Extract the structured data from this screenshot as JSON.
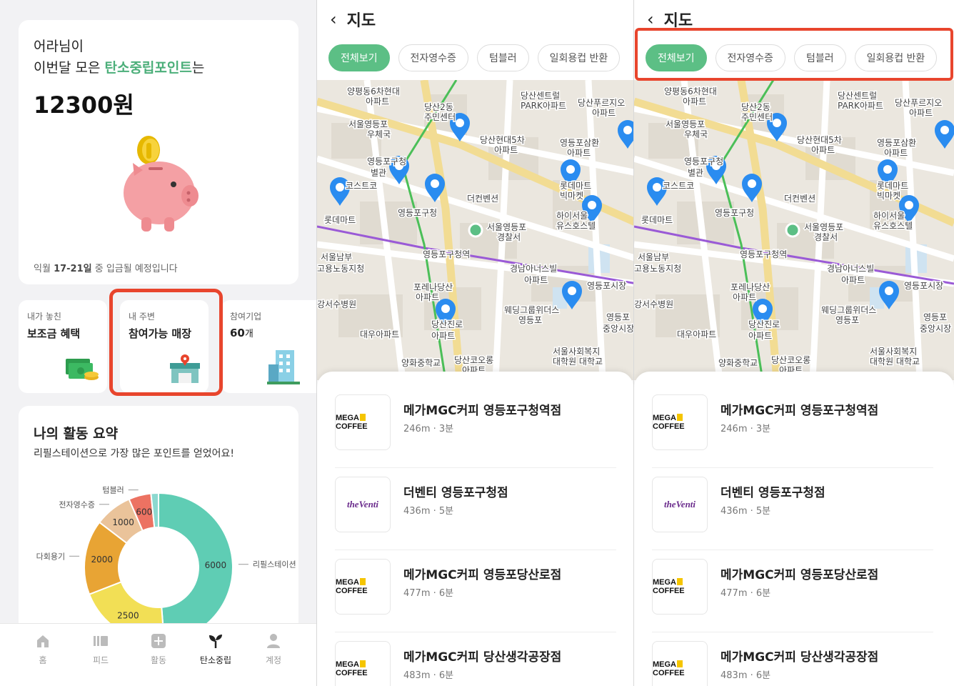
{
  "panel1": {
    "greeting_line1": "어라님이",
    "greeting_prefix": "이번달 모은 ",
    "greeting_accent": "탄소중립포인트",
    "greeting_suffix": "는",
    "amount": "12300원",
    "deposit_note_prefix": "익월 ",
    "deposit_note_bold": "17-21일",
    "deposit_note_suffix": " 중 입금될 예정입니다",
    "mini_cards": [
      {
        "title": "내가 놓친",
        "value": "보조금 혜택"
      },
      {
        "title": "내 주변",
        "value": "참여가능 매장"
      },
      {
        "title": "참여기업",
        "value_num": "60",
        "value_unit": "개"
      }
    ],
    "activity": {
      "title": "나의 활동 요약",
      "subtitle": "리필스테이션으로 가장 많은 포인트를 얻었어요!"
    },
    "tabs": [
      "홈",
      "피드",
      "활동",
      "탄소중립",
      "계정"
    ],
    "active_tab": "탄소중립"
  },
  "chart_data": {
    "type": "pie",
    "style": "donut",
    "segments": [
      {
        "label": "리필스테이션",
        "value": 6000,
        "color": "#5fcdb4"
      },
      {
        "label": "",
        "value": 2500,
        "color": "#f2df55"
      },
      {
        "label": "다회용기",
        "value": 2000,
        "color": "#e8a434"
      },
      {
        "label": "전자영수증",
        "value": 1000,
        "color": "#eac39a"
      },
      {
        "label": "텀블러",
        "value": 600,
        "color": "#ec7262"
      },
      {
        "label": "",
        "value": 200,
        "color": "#8cd8cf"
      }
    ]
  },
  "map_screen": {
    "title": "지도",
    "back_icon": "chevron-left-icon",
    "chips": [
      "전체보기",
      "전자영수증",
      "텀블러",
      "일회용컵 반환"
    ],
    "active_chip": "전체보기",
    "map_labels": [
      "양평동6차현대",
      "아파트",
      "당산2동",
      "주민센터",
      "당산센트럴",
      "PARK아파트",
      "당산푸르지오",
      "아파트",
      "서울영등포",
      "우체국",
      "당산현대5차",
      "아파트",
      "영등포삼환",
      "아파트",
      "영등포구청",
      "별관",
      "롯데마트",
      "빅마켓",
      "코스트코",
      "롯데마트",
      "영등포구청",
      "더컨벤션",
      "서울영등포",
      "경찰서",
      "하이서울",
      "유스호스텔",
      "서울남부",
      "고용노동지청",
      "영등포구청역",
      "경남아너스빌",
      "아파트",
      "영등포시장",
      "포레나당산",
      "아파트",
      "강서수병원",
      "웨딩그룹위더스",
      "영등포",
      "영등포",
      "중앙시장",
      "대우아파트",
      "당산진로",
      "아파트",
      "양화중학교",
      "당산코오롱",
      "아파트",
      "서울사회복지",
      "대학원 대학교"
    ],
    "stores": [
      {
        "brand": "mega",
        "name": "메가MGC커피 영등포구청역점",
        "distance": "246m",
        "time": "3분"
      },
      {
        "brand": "venti",
        "name": "더벤티 영등포구청점",
        "distance": "436m",
        "time": "5분"
      },
      {
        "brand": "mega",
        "name": "메가MGC커피 영등포당산로점",
        "distance": "477m",
        "time": "6분"
      },
      {
        "brand": "mega",
        "name": "메가MGC커피 당산생각공장점",
        "distance": "483m",
        "time": "6분"
      }
    ],
    "logo_text": {
      "mega_left": "MEGA",
      "mega_right": "COFFEE",
      "venti": "theVenti"
    },
    "dot": " · "
  },
  "colors": {
    "accent": "#5cbf85",
    "highlight": "#e8452d",
    "pin": "#2a8cf0"
  }
}
